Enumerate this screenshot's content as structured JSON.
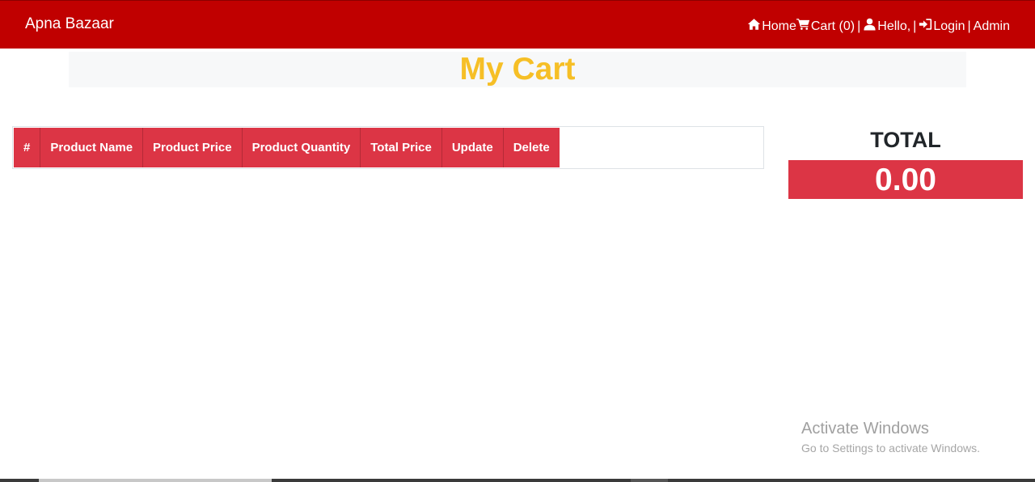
{
  "navbar": {
    "brand": "Apna Bazaar",
    "home_label": "Home",
    "cart_label": "Cart (0)",
    "hello_label": "Hello,",
    "login_label": "Login",
    "admin_label": "Admin",
    "separator": "|",
    "background": "#c00000",
    "icons": [
      "home-icon",
      "cart-icon",
      "user-icon",
      "sign-in-icon"
    ]
  },
  "page": {
    "title": "My Cart",
    "title_color": "#f6bf26"
  },
  "cart_table": {
    "headers": [
      "#",
      "Product Name",
      "Product Price",
      "Product Quantity",
      "Total Price",
      "Update",
      "Delete"
    ],
    "rows": [],
    "header_color": "#dc3545"
  },
  "summary": {
    "label": "TOTAL",
    "value": "0.00"
  },
  "watermark": {
    "line1": "Activate Windows",
    "line2": "Go to Settings to activate Windows."
  }
}
